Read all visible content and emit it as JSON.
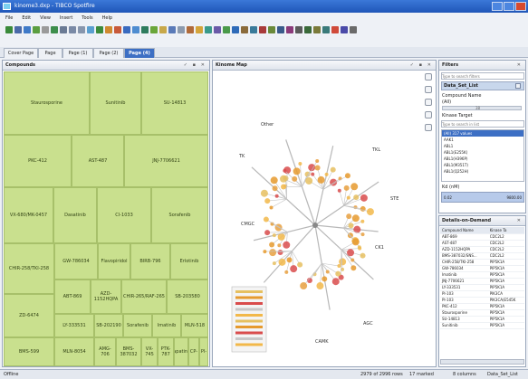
{
  "window": {
    "title": "kinome3.dxp - TIBCO Spotfire",
    "buttons": [
      "minimize",
      "maximize",
      "close"
    ]
  },
  "menu": [
    "File",
    "Edit",
    "View",
    "Insert",
    "Tools",
    "Help"
  ],
  "toolbar_icons": [
    {
      "name": "filter-icon",
      "color": "#3a8a3a"
    },
    {
      "name": "arrow-icon",
      "color": "#4a6aa8"
    },
    {
      "name": "marking-icon",
      "color": "#3f7ac8"
    },
    {
      "name": "pan-icon",
      "color": "#5b9e40"
    },
    {
      "name": "lasso-icon",
      "color": "#9a9a9a"
    },
    {
      "name": "refresh-icon",
      "color": "#3d8e4c"
    },
    {
      "name": "table-icon",
      "color": "#6a7a94"
    },
    {
      "name": "cross-table-icon",
      "color": "#7a8aa6"
    },
    {
      "name": "graphical-table-icon",
      "color": "#8796ad"
    },
    {
      "name": "bar-chart-icon",
      "color": "#5a9fd0"
    },
    {
      "name": "line-chart-icon",
      "color": "#3c8b3c"
    },
    {
      "name": "combination-chart-icon",
      "color": "#d08a30"
    },
    {
      "name": "pie-chart-icon",
      "color": "#c85a3a"
    },
    {
      "name": "scatter-plot-icon",
      "color": "#3a6bc0"
    },
    {
      "name": "3d-scatter-icon",
      "color": "#4e8cd0"
    },
    {
      "name": "map-chart-icon",
      "color": "#2e7c5e"
    },
    {
      "name": "treemap-icon",
      "color": "#6aa63a"
    },
    {
      "name": "heat-map-icon",
      "color": "#c8a84a"
    },
    {
      "name": "parallel-coordinates-icon",
      "color": "#5a7ab8"
    },
    {
      "name": "summary-table-icon",
      "color": "#8c9aae"
    },
    {
      "name": "box-plot-icon",
      "color": "#b06a3a"
    },
    {
      "name": "text-area-icon",
      "color": "#d4a43a"
    },
    {
      "name": "image-icon",
      "color": "#3a9a8a"
    },
    {
      "name": "legend-icon",
      "color": "#6a5aa8"
    },
    {
      "name": "details-icon",
      "color": "#4a9a4a"
    },
    {
      "name": "filter-panel-icon",
      "color": "#2e6ab8"
    },
    {
      "name": "data-table-icon",
      "color": "#8a6a3a"
    },
    {
      "name": "bookmark-icon",
      "color": "#3a7a9a"
    },
    {
      "name": "collaboration-icon",
      "color": "#a83a3a"
    },
    {
      "name": "tag-icon",
      "color": "#6a8a3a"
    },
    {
      "name": "list-icon",
      "color": "#3a5a8a"
    },
    {
      "name": "export-icon",
      "color": "#8a3a7a"
    },
    {
      "name": "print-icon",
      "color": "#5a5a5a"
    },
    {
      "name": "search-icon",
      "color": "#3a6a3a"
    },
    {
      "name": "settings-icon",
      "color": "#7a7a3a"
    },
    {
      "name": "zoom-icon",
      "color": "#3a7a7a"
    },
    {
      "name": "help-icon",
      "color": "#d04a3a"
    },
    {
      "name": "info-icon",
      "color": "#4a4aa8"
    },
    {
      "name": "more-icon",
      "color": "#6a6a6a"
    }
  ],
  "tabs": [
    "Cover Page",
    "Page",
    "Page (1)",
    "Page (2)",
    "Page (4)"
  ],
  "active_tab": "Page (4)",
  "compounds": {
    "title": "Compounds",
    "tiles": [
      "Staurosporine",
      "Sunitinib",
      "SU-14813",
      "PKC-412",
      "AST-487",
      "JNJ-7706621",
      "VX-680/MK-0457",
      "Dasatinib",
      "CI-1033",
      "Sorafenib",
      "CHIR-258/TKI-258",
      "GW-786034",
      "Flavopiridol",
      "BIRB-796",
      "Erlotinib",
      "ABT-869",
      "AZD-1152HQPA",
      "CHIR-265/RAF-265",
      "SB-203580",
      "ZD-6474",
      "LY-333531",
      "SB-202190",
      "Sorafenib",
      "Imatinib",
      "MLN-518",
      "BMS-599",
      "MLN-8054",
      "AMG-706",
      "BMS-387032",
      "VX-745",
      "PTK-787",
      "Lapatinib",
      "CP-",
      "PI-"
    ],
    "colors": {
      "tile": "#c9e08e",
      "tile_border": "#a7c06a"
    }
  },
  "kinome_map": {
    "title": "Kinome Map",
    "group_labels": [
      "TK",
      "TKL",
      "STE",
      "CK1",
      "AGC",
      "CAMK",
      "CMGC",
      "Other"
    ]
  },
  "filters": {
    "title": "Filters",
    "search_placeholder": "Type to search filters",
    "dataset": "Data_Set_List",
    "compound_name_label": "Compound Name",
    "compound_name_value": "(All)",
    "compound_name_count": "38",
    "kinase_target_label": "Kinase Target",
    "kinase_search_placeholder": "Type to search in list",
    "kinase_items": [
      "(All) 317 values",
      "AAK1",
      "ABL1",
      "ABL1(E255K)",
      "ABL1(H396P)",
      "ABL1(M351T)",
      "ABL1(Q252H)"
    ],
    "kd_label": "Kd (nM)",
    "kd_min": "0.02",
    "kd_max": "9800.00"
  },
  "details": {
    "title": "Details-on-Demand",
    "columns": [
      "Compound Name",
      "Kinase Ta"
    ],
    "rows": [
      [
        "ABT-869",
        "CDC2L2"
      ],
      [
        "AST-487",
        "CDC2L2"
      ],
      [
        "AZD-1152HQPA",
        "CDC2L2"
      ],
      [
        "BMS-387032/SNS...",
        "CDC2L2"
      ],
      [
        "CHIR-258/TKI-258",
        "PIP5K1A"
      ],
      [
        "GW-786034",
        "PIP5K1A"
      ],
      [
        "Imatinib",
        "PIP5K1A"
      ],
      [
        "JNJ-7706621",
        "PIP5K1A"
      ],
      [
        "LY-333531",
        "PIP5K1A"
      ],
      [
        "PI-103",
        "PIK3CA"
      ],
      [
        "PI-103",
        "PIK3CA(E545K"
      ],
      [
        "PKC-412",
        "PIP5K1A"
      ],
      [
        "Staurosporine",
        "PIP5K1A"
      ],
      [
        "SU-14813",
        "PIP5K1A"
      ],
      [
        "Sunitinib",
        "PIP5K1A"
      ]
    ]
  },
  "status": {
    "left": "Offline",
    "rows": "2979 of 2996 rows",
    "marked": "17 marked",
    "columns": "8 columns",
    "table": "Data_Set_List"
  }
}
